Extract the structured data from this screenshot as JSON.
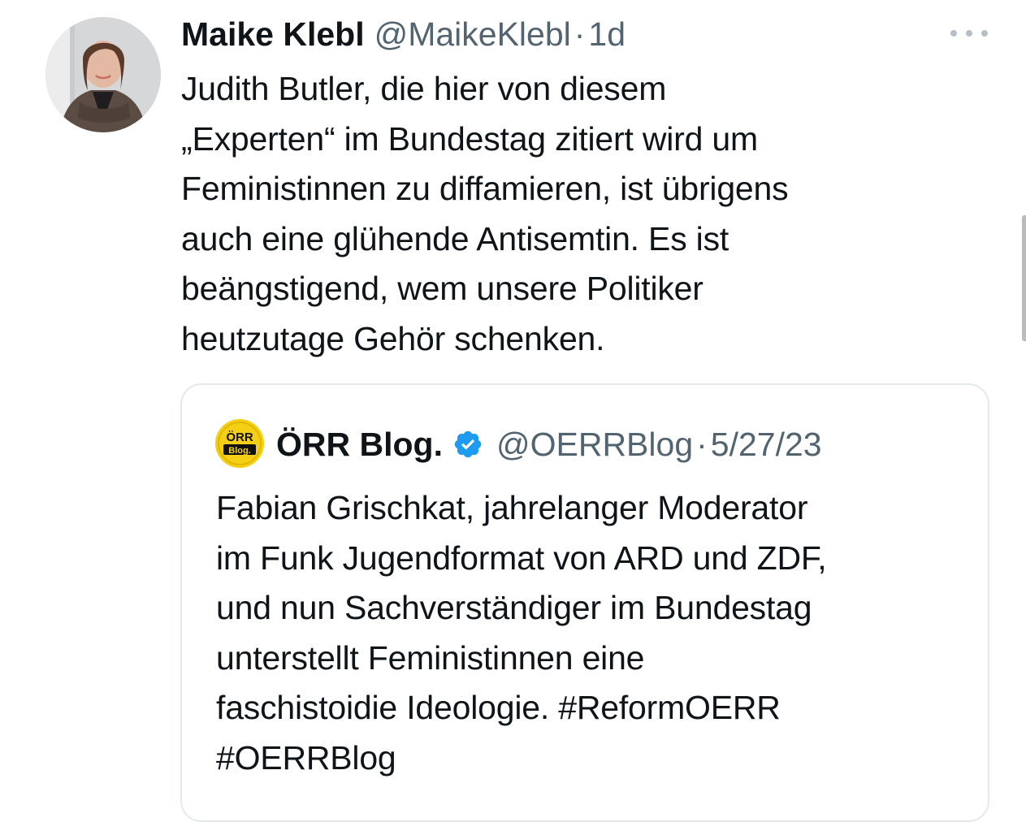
{
  "tweet": {
    "author": {
      "name": "Maike Klebl",
      "handle": "@MaikeKlebl",
      "separator": "·",
      "time": "1d",
      "avatar_icon": "profile-photo"
    },
    "more_icon": "more-horizontal-icon",
    "text_lines": [
      "Judith Butler, die hier von diesem",
      "„Experten“ im Bundestag zitiert wird um",
      "Feministinnen zu diffamieren, ist übrigens",
      "auch eine glühende Antisemtin. Es ist",
      "beängstigend, wem unsere Politiker",
      "heutzutage Gehör schenken."
    ]
  },
  "quote": {
    "author": {
      "name": "ÖRR Blog.",
      "verified_icon": "verified-badge-icon",
      "verified_color": "#1d9bf0",
      "handle": "@OERRBlog",
      "separator": "·",
      "date": "5/27/23",
      "avatar_lines": [
        "ÖRR",
        "Blog."
      ]
    },
    "text_lines": [
      "Fabian Grischkat, jahrelanger Moderator",
      "im Funk Jugendformat von ARD und ZDF,",
      "und nun Sachverständiger im Bundestag",
      "unterstellt Feministinnen eine",
      "faschistoidie Ideologie. #ReformOERR",
      "#OERRBlog"
    ]
  },
  "colors": {
    "text": "#0f1419",
    "secondary": "#536471",
    "border": "#e4e8eb",
    "accent": "#1d9bf0"
  }
}
